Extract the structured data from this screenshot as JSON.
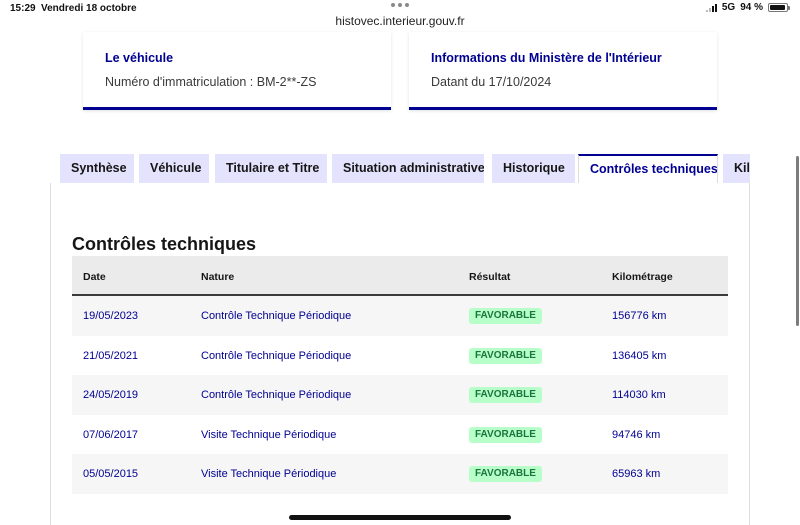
{
  "status_bar": {
    "time": "15:29",
    "date": "Vendredi 18 octobre",
    "network": "5G",
    "battery": "94 %",
    "battery_level": 0.94,
    "icons": [
      "signal-icon",
      "battery-icon"
    ]
  },
  "browser": {
    "url": "histovec.interieur.gouv.fr"
  },
  "cards": [
    {
      "title": "Le véhicule",
      "text": "Numéro d'immatriculation : BM-2**-ZS"
    },
    {
      "title": "Informations du Ministère de l'Intérieur",
      "text": "Datant du 17/10/2024"
    }
  ],
  "tabs": [
    {
      "label": "Synthèse",
      "active": false
    },
    {
      "label": "Véhicule",
      "active": false
    },
    {
      "label": "Titulaire et Titre",
      "active": false
    },
    {
      "label": "Situation administrative",
      "active": false
    },
    {
      "label": "Historique",
      "active": false
    },
    {
      "label": "Contrôles techniques",
      "active": true
    },
    {
      "label": "Kilométrage",
      "active": false
    }
  ],
  "section": {
    "title": "Contrôles techniques",
    "columns": [
      "Date",
      "Nature",
      "Résultat",
      "Kilométrage"
    ],
    "rows": [
      {
        "date": "19/05/2023",
        "nature": "Contrôle Technique Périodique",
        "result": "FAVORABLE",
        "km": "156776 km"
      },
      {
        "date": "21/05/2021",
        "nature": "Contrôle Technique Périodique",
        "result": "FAVORABLE",
        "km": "136405 km"
      },
      {
        "date": "24/05/2019",
        "nature": "Contrôle Technique Périodique",
        "result": "FAVORABLE",
        "km": "114030 km"
      },
      {
        "date": "07/06/2017",
        "nature": "Visite Technique Périodique",
        "result": "FAVORABLE",
        "km": "94746 km"
      },
      {
        "date": "05/05/2015",
        "nature": "Visite Technique Périodique",
        "result": "FAVORABLE",
        "km": "65963 km"
      }
    ]
  },
  "colors": {
    "primary_blue": "#000091",
    "tab_background": "#e3e3fd",
    "badge_background": "#b8fec9",
    "badge_text": "#18753c",
    "header_row": "#ebebeb"
  }
}
